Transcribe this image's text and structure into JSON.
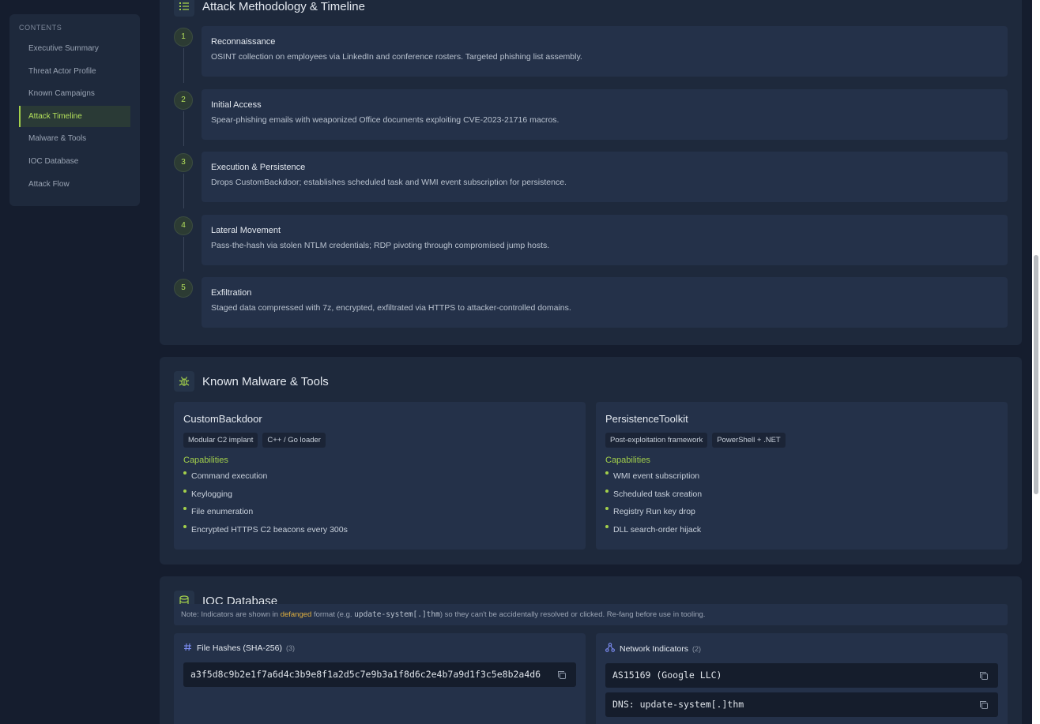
{
  "sidebar": {
    "title": "CONTENTS",
    "items": [
      {
        "label": "Executive Summary"
      },
      {
        "label": "Threat Actor Profile"
      },
      {
        "label": "Known Campaigns"
      },
      {
        "label": "Attack Timeline"
      },
      {
        "label": "Malware & Tools"
      },
      {
        "label": "IOC Database"
      },
      {
        "label": "Attack Flow"
      }
    ],
    "active_item": "Attack Timeline"
  },
  "timeline": {
    "title": "Attack Methodology & Timeline",
    "icon": "list-ordered-icon",
    "steps": [
      {
        "num": "1",
        "title": "Reconnaissance",
        "desc": "OSINT collection on employees via LinkedIn and conference rosters. Targeted phishing list assembly."
      },
      {
        "num": "2",
        "title": "Initial Access",
        "desc": "Spear-phishing emails with weaponized Office documents exploiting CVE-2023-21716 macros."
      },
      {
        "num": "3",
        "title": "Execution & Persistence",
        "desc": "Drops CustomBackdoor; establishes scheduled task and WMI event subscription for persistence."
      },
      {
        "num": "4",
        "title": "Lateral Movement",
        "desc": "Pass-the-hash via stolen NTLM credentials; RDP pivoting through compromised jump hosts."
      },
      {
        "num": "5",
        "title": "Exfiltration",
        "desc": "Staged data compressed with 7z, encrypted, exfiltrated via HTTPS to attacker-controlled domains."
      }
    ]
  },
  "malware": {
    "title": "Known Malware & Tools",
    "icon": "bug-icon",
    "tools": [
      {
        "name": "CustomBackdoor",
        "tags": [
          "Modular C2 implant",
          "C++ / Go loader"
        ],
        "cap_label": "Capabilities",
        "capabilities": [
          "Command execution",
          "Keylogging",
          "File enumeration",
          "Encrypted HTTPS C2 beacons every 300s"
        ]
      },
      {
        "name": "PersistenceToolkit",
        "tags": [
          "Post-exploitation framework",
          "PowerShell + .NET"
        ],
        "cap_label": "Capabilities",
        "capabilities": [
          "WMI event subscription",
          "Scheduled task creation",
          "Registry Run key drop",
          "DLL search-order hijack"
        ]
      }
    ]
  },
  "ioc": {
    "title": "IOC Database",
    "icon": "database-icon",
    "note": {
      "prefix": "Note: Indicators are shown in ",
      "highlight": "defanged",
      "middle": " format (e.g. ",
      "example": "update-system[.]thm",
      "suffix": ") so they can't be accidentally resolved or clicked. Re-fang before use in tooling."
    },
    "hashes": {
      "title": "File Hashes (SHA-256)",
      "count": "(3)",
      "items": [
        "a3f5d8c9b2e1f7a6d4c3b9e8f1a2d5c7e9b3a1f8d6c2e4b7a9d1f3c5e8b2a4d6"
      ]
    },
    "network": {
      "title": "Network Indicators",
      "count": "(2)",
      "items": [
        "AS15169 (Google LLC)",
        "DNS: update-system[.]thm"
      ]
    }
  },
  "colors": {
    "accent": "#a3d04b",
    "background": "#151d2e",
    "panel": "#1e293c",
    "card": "#243149",
    "highlight": "#e0b040"
  }
}
